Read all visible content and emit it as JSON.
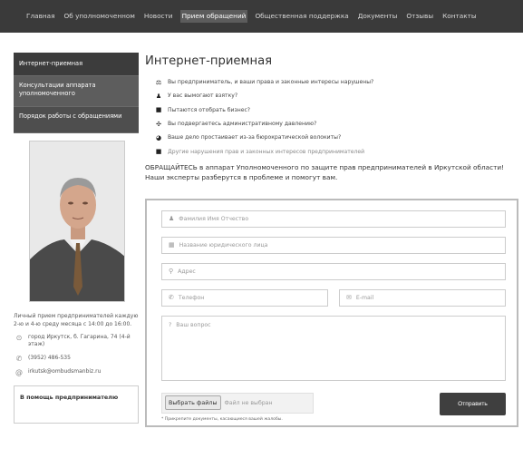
{
  "nav": {
    "items": [
      {
        "label": "Главная",
        "active": false
      },
      {
        "label": "Об уполномоченном",
        "active": false
      },
      {
        "label": "Новости",
        "active": false
      },
      {
        "label": "Прием обращений",
        "active": true
      },
      {
        "label": "Общественная поддержка",
        "active": false
      },
      {
        "label": "Документы",
        "active": false
      },
      {
        "label": "Отзывы",
        "active": false
      },
      {
        "label": "Контакты",
        "active": false
      }
    ]
  },
  "sidebar": {
    "menu": [
      {
        "label": "Интернет-приемная"
      },
      {
        "label": "Консультации аппарата уполномоченного"
      },
      {
        "label": "Порядок работы с обращениями"
      }
    ],
    "reception": "Личный прием предпринимателей каждую 2-ю и 4-ю среду месяца с 14:00 до 16:00.",
    "address": "город Иркутск, б. Гагарина, 74 (4-й этаж)",
    "phone": "(3952) 486-535",
    "email": "irkutsk@ombudsmanbiz.ru",
    "help_title": "В помощь предпринимателю"
  },
  "main": {
    "title": "Интернет-приемная",
    "issues": [
      {
        "icon": "gavel-icon",
        "glyph": "⚖",
        "text": "Вы предприниматель, и ваши права и законные интересы нарушены?"
      },
      {
        "icon": "money-bag-icon",
        "glyph": "💰",
        "text": "У вас вымогают взятку?"
      },
      {
        "icon": "briefcase-icon",
        "glyph": "■",
        "text": "Пытаются отобрать бизнес?"
      },
      {
        "icon": "balance-icon",
        "glyph": "✣",
        "text": "Вы подвергаетесь административному давлению?"
      },
      {
        "icon": "clock-icon",
        "glyph": "◕",
        "text": "Ваше дело простаивает из-за бюрократической волокиты?"
      },
      {
        "icon": "document-icon",
        "glyph": "■",
        "text": "Другие нарушения прав и законных интересов предпринимателей"
      }
    ],
    "intro": "ОБРАЩАЙТЕСЬ в аппарат Уполномоченного по защите прав предпринимателей в Иркутской области! Наши эксперты разберутся в проблеме и помогут вам."
  },
  "form": {
    "name_placeholder": "Фамилия Имя Отчество",
    "company_placeholder": "Название юридического лица",
    "address_placeholder": "Адрес",
    "phone_placeholder": "Телефон",
    "email_placeholder": "E-mail",
    "question_placeholder": "Ваш вопрос",
    "file_button": "Выбрать файлы",
    "file_status": "Файл не выбран",
    "file_note": "* Прикрепите документы, касающиеся вашей жалобы.",
    "submit": "Отправить"
  }
}
